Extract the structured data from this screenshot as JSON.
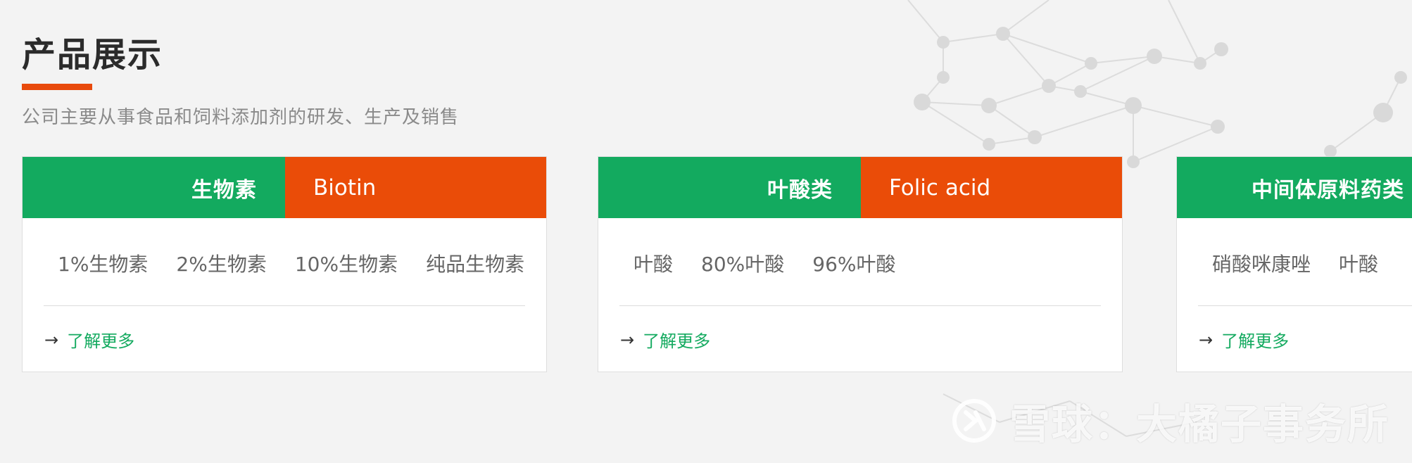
{
  "header": {
    "title": "产品展示",
    "subtitle": "公司主要从事食品和饲料添加剂的研发、生产及销售"
  },
  "cards": [
    {
      "cn": "生物素",
      "en": "Biotin",
      "products": [
        "1%生物素",
        "2%生物素",
        "10%生物素",
        "纯品生物素"
      ],
      "more": "了解更多"
    },
    {
      "cn": "叶酸类",
      "en": "Folic acid",
      "products": [
        "叶酸",
        "80%叶酸",
        "96%叶酸"
      ],
      "more": "了解更多"
    },
    {
      "cn": "中间体原料药类",
      "en": "",
      "products": [
        "硝酸咪康唑",
        "叶酸"
      ],
      "more": "了解更多"
    }
  ],
  "watermark": {
    "text": "雪球：大橘子事务所"
  },
  "icons": {
    "arrow": "arrow-right-icon",
    "logo": "xueqiu-logo-icon"
  },
  "colors": {
    "accent_green": "#13aa5f",
    "accent_orange": "#ea4c08"
  }
}
